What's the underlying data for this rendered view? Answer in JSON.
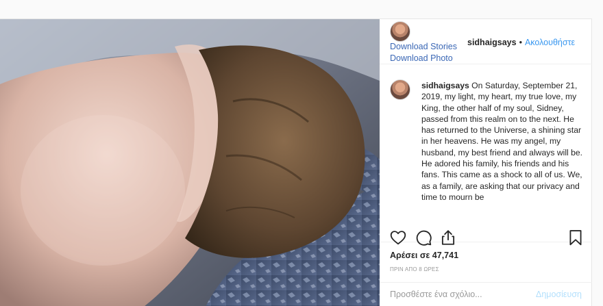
{
  "header": {
    "download_stories": "Download Stories",
    "download_photo": "Download Photo",
    "username": "sidhaigsays",
    "separator": "•",
    "follow_label": "Ακολουθήστε"
  },
  "caption": {
    "username": "sidhaigsays",
    "text": "On Saturday, September 21, 2019, my light, my heart, my true love, my King, the other half of my soul, Sidney, passed from this realm on to the next. He has returned to the Universe, a shining star in her heavens. He was my angel, my husband, my best friend and always will be. He adored his family, his friends and his fans. This came as a shock to all of us. We, as a family, are asking that our privacy and time to mourn be"
  },
  "actions": {
    "like_icon": "heart-icon",
    "comment_icon": "comment-bubble-icon",
    "share_icon": "share-upload-icon",
    "save_icon": "bookmark-icon"
  },
  "likes_text": "Αρέσει σε 47,741",
  "timestamp": "ΠΡΙΝ ΑΠΟ 8 ΩΡΕΣ",
  "comment_box": {
    "placeholder": "Προσθέστε ένα σχόλιο...",
    "post_label": "Δημοσίευση"
  },
  "colors": {
    "link_blue": "#3897f0",
    "download_link": "#3a67b5",
    "post_button_disabled": "#b2dffc",
    "text": "#262626",
    "muted": "#999999"
  }
}
